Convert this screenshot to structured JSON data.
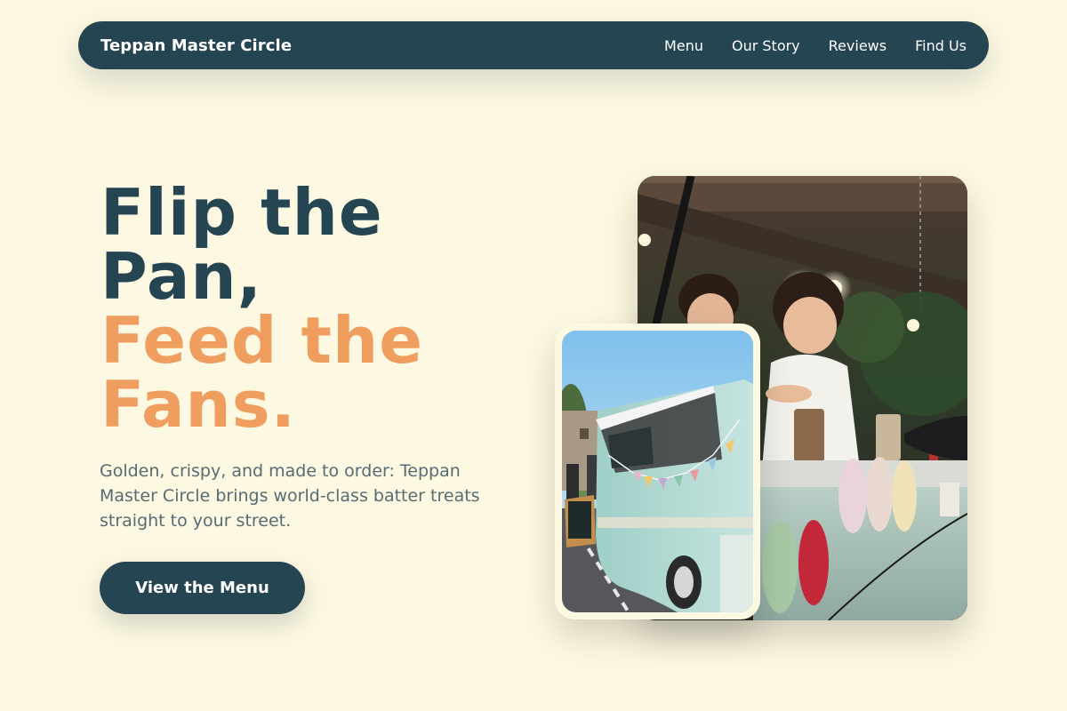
{
  "nav": {
    "brand": "Teppan Master Circle",
    "links": [
      {
        "label": "Menu"
      },
      {
        "label": "Our Story"
      },
      {
        "label": "Reviews"
      },
      {
        "label": "Find Us"
      }
    ]
  },
  "hero": {
    "title_line1": "Flip the",
    "title_line2": "Pan,",
    "title_line3": "Feed the",
    "title_line4": "Fans.",
    "description": "Golden, crispy, and made to order: Teppan Master Circle brings world-class batter treats straight to your street.",
    "cta_label": "View the Menu"
  },
  "images": {
    "main_photo": "food-truck-stall-photo",
    "secondary_photo": "camper-van-food-truck-photo"
  },
  "colors": {
    "background": "#fdf8e1",
    "primary": "#264553",
    "accent": "#ef9e5f",
    "body_text": "#566b74"
  }
}
